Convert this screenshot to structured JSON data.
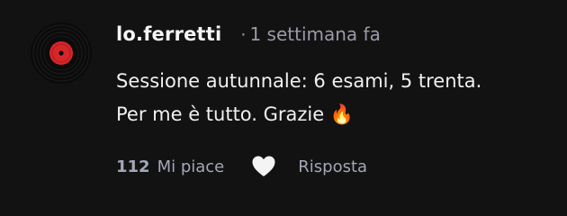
{
  "comment": {
    "username": "lo.ferretti",
    "separator": "·",
    "timestamp": "1 settimana fa",
    "text": "Sessione autunnale: 6 esami, 5 trenta. Per me è tutto. Grazie",
    "emoji": "🔥",
    "avatar_icon": "vinyl-record-avatar",
    "likes": {
      "count": "112",
      "label": "Mi piace",
      "heart_icon": "heart-outline-icon"
    },
    "reply_label": "Risposta"
  },
  "colors": {
    "background": "#121212",
    "text_primary": "#f0f0f0",
    "text_muted": "#a3a7b8",
    "avatar_accent": "#d7262a"
  }
}
